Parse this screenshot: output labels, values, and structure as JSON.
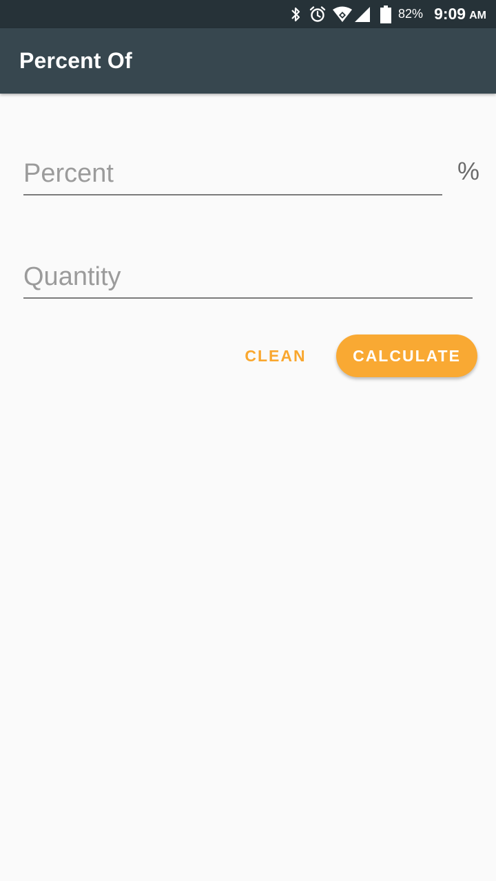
{
  "status_bar": {
    "icons": [
      "bluetooth-icon",
      "alarm-icon",
      "wifi-icon",
      "cell-signal-icon",
      "battery-icon"
    ],
    "battery": "82%",
    "time": "9:09",
    "ampm": "AM"
  },
  "app_bar": {
    "title": "Percent Of"
  },
  "form": {
    "percent_placeholder": "Percent",
    "percent_value": "",
    "percent_sign": "%",
    "quantity_placeholder": "Quantity",
    "quantity_value": ""
  },
  "actions": {
    "clean_label": "CLEAN",
    "calculate_label": "CALCULATE"
  },
  "colors": {
    "status_bar_bg": "#263238",
    "app_bar_bg": "#37474f",
    "accent": "#f9a933",
    "background": "#fafafa"
  }
}
